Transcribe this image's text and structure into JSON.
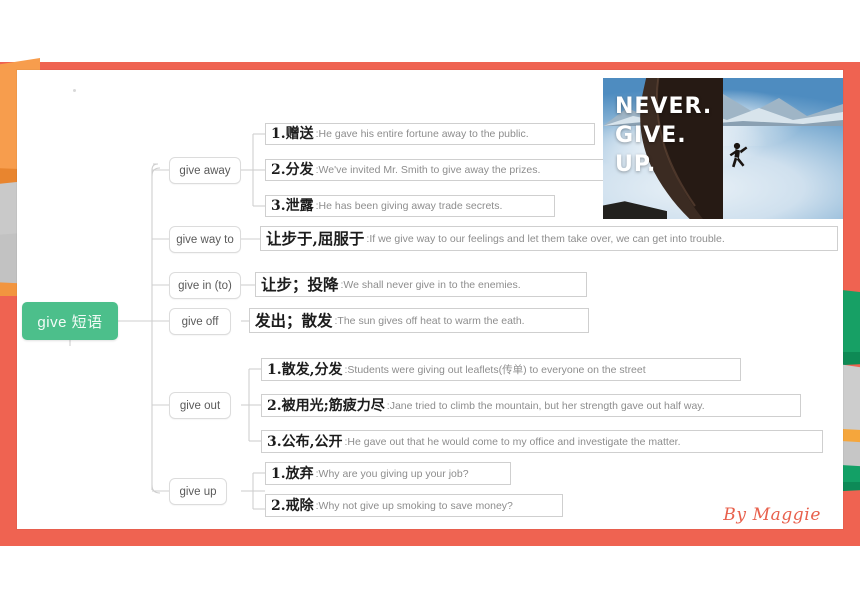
{
  "slide": {
    "frame_color": "#ef6351",
    "canvas_color": "#ffffff",
    "signature": "By Maggie"
  },
  "mindmap": {
    "root": {
      "label": "give 短语",
      "color": "#4cbf8b"
    },
    "branches": [
      {
        "label": "give away",
        "leaves": [
          {
            "num": "1.",
            "cn": "赠送",
            "en": ":He gave his entire fortune away to the public."
          },
          {
            "num": "2.",
            "cn": "分发",
            "en": ":We've invited Mr. Smith to give away the prizes."
          },
          {
            "num": "3.",
            "cn": "泄露",
            "en": ":He has been giving away trade secrets."
          }
        ]
      },
      {
        "label": "give way to",
        "leaves": [
          {
            "num": "",
            "cn": "让步于,屈服于",
            "en": ":If we give way to our feelings and let them take over, we can get into trouble."
          }
        ]
      },
      {
        "label": "give in (to)",
        "leaves": [
          {
            "num": "",
            "cn": "让步；投降",
            "en": ":We shall never give in to the enemies."
          }
        ]
      },
      {
        "label": "give off",
        "leaves": [
          {
            "num": "",
            "cn": "发出；散发",
            "en": ":The sun gives off heat to warm the eath."
          }
        ]
      },
      {
        "label": "give out",
        "leaves": [
          {
            "num": "1.",
            "cn": "散发,分发",
            "en": ":Students were giving out leaflets(传单) to everyone on the street"
          },
          {
            "num": "2.",
            "cn": "被用光;筋疲力尽",
            "en": ":Jane tried to climb the mountain, but her strength gave out half way."
          },
          {
            "num": "3.",
            "cn": "公布,公开",
            "en": ":He gave out that he would come to my office and investigate the matter."
          }
        ]
      },
      {
        "label": "give up",
        "leaves": [
          {
            "num": "1.",
            "cn": "放弃",
            "en": ":Why are you giving up your job?"
          },
          {
            "num": "2.",
            "cn": "戒除",
            "en": ":Why not give up smoking to save money?"
          }
        ]
      }
    ]
  },
  "photo": {
    "line1": "NEVER.",
    "line2": "GIVE.",
    "line3": "UP."
  }
}
